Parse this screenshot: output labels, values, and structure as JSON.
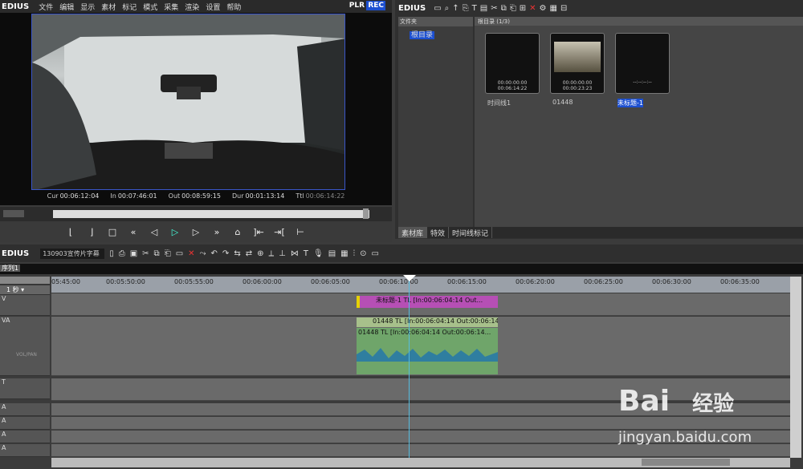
{
  "app": {
    "logo": "EDIUS",
    "menus": [
      "文件",
      "编辑",
      "显示",
      "素材",
      "标记",
      "模式",
      "采集",
      "渲染",
      "设置",
      "帮助"
    ],
    "plr": "PLR",
    "rec": "REC"
  },
  "player": {
    "cur": "00:06:12:04",
    "in": "00:07:46:01",
    "out": "00:08:59:15",
    "dur": "00:01:13:14",
    "ttl": "00:06:14:22"
  },
  "bin": {
    "title": "EDIUS",
    "folder_header": "文件夹",
    "root": "根目录",
    "clips_header": "根目录 (1/3)",
    "clips": [
      {
        "name": "时间线1",
        "tc": "00:00:00:00\n00:06:14:22"
      },
      {
        "name": "01448",
        "tc": "00:00:00:00\n00:00:23:23"
      },
      {
        "name": "未标题-1",
        "tc": "--:--:--:--"
      }
    ],
    "tabs": [
      "素材库",
      "特效",
      "时间线标记"
    ]
  },
  "timeline": {
    "logo": "EDIUS",
    "project": "130903宣传片字幕",
    "seq_tab": "序列1",
    "scale": "1 秒",
    "ruler": [
      "05:45:00",
      "00:05:50:00",
      "00:05:55:00",
      "00:06:00:00",
      "00:06:05:00",
      "00:06:10:00",
      "00:06:15:00",
      "00:06:20:00",
      "00:06:25:00",
      "00:06:30:00",
      "00:06:35:00"
    ],
    "vtrack": "V",
    "vatrack": "VA",
    "ttrack": "T",
    "atrack": "A",
    "clip_title": "未标题-1  TL [In:00:06:04:14 Out...",
    "clip_video": "01448  TL [In:00:06:04:14 Out:00:06:14...",
    "clip_audio": "01448  TL [In:00:06:04:14 Out:00:06:14...",
    "volpan": "VOL/PAN"
  },
  "watermark": {
    "brand": "Bai",
    "brand2": "经验",
    "url": "jingyan.baidu.com"
  }
}
